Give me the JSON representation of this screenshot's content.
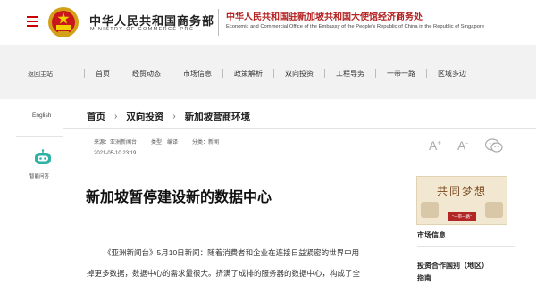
{
  "header": {
    "mofcom_cn": "中华人民共和国商务部",
    "mofcom_en": "MINISTRY OF COMMERCE PRC",
    "office_cn": "中华人民共和国驻新加坡共和国大使馆经济商务处",
    "office_en": "Economic and Commercial Office of the Embassy of the People's Republic of China in the Republic of Singapore"
  },
  "nav": {
    "home_link": "返回主站",
    "items": [
      {
        "label": "首页"
      },
      {
        "label": "经贸动态"
      },
      {
        "label": "市场信息"
      },
      {
        "label": "政策解析"
      },
      {
        "label": "双向投资"
      },
      {
        "label": "工程导务"
      },
      {
        "label": "一带一路"
      },
      {
        "label": "区域多边"
      }
    ]
  },
  "sidebar": {
    "english": "English",
    "robot_label": "智能问答"
  },
  "breadcrumb": [
    "首页",
    "双向投资",
    "新加坡营商环境"
  ],
  "article": {
    "source_label": "来源：亚洲新闻台",
    "type_label": "类型：编译",
    "category_label": "分类：新闻",
    "date": "2021-05-10 23:19",
    "title": "新加坡暂停建设新的数据中心",
    "body_line1": "《亚洲新闻台》5月10日新闻：随着消费者和企业在连接日益紧密的世界中用",
    "body_line2": "掉更多数据，数据中心的需求量很大。挤满了成排的服务器的数据中心，构成了全"
  },
  "tools": {
    "larger": "A",
    "smaller": "A",
    "larger_sup": "+",
    "smaller_sup": "-"
  },
  "right_sidebar": {
    "banner_title": "共同梦想",
    "banner_sub": "\"一带一路\"",
    "heading1": "市场信息",
    "heading2": "投资合作国别（地区）",
    "heading2_cont": "指南"
  },
  "colors": {
    "brand_red": "#b41f1f",
    "nav_bg": "#f2f2f2",
    "robot_teal": "#2fb2a4"
  }
}
